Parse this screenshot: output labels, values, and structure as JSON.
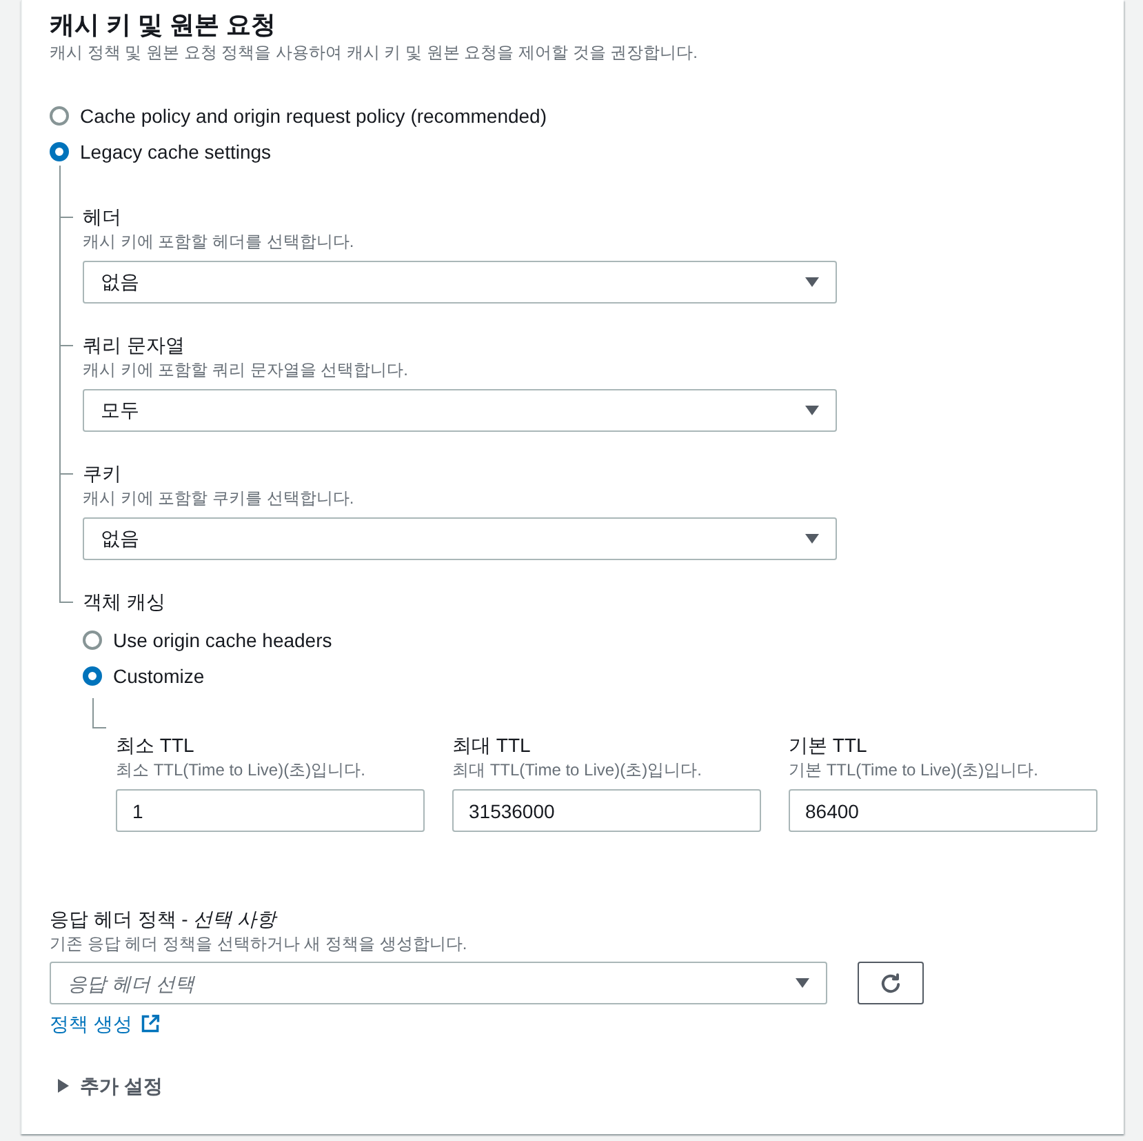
{
  "section": {
    "title": "캐시 키 및 원본 요청",
    "description": "캐시 정책 및 원본 요청 정책을 사용하여 캐시 키 및 원본 요청을 제어할 것을 권장합니다."
  },
  "cache_options": [
    {
      "label": "Cache policy and origin request policy (recommended)",
      "selected": false
    },
    {
      "label": "Legacy cache settings",
      "selected": true
    }
  ],
  "legacy_settings": {
    "fields": [
      {
        "label": "헤더",
        "description": "캐시 키에 포함할 헤더를 선택합니다.",
        "value": "없음"
      },
      {
        "label": "쿼리 문자열",
        "description": "캐시 키에 포함할 쿼리 문자열을 선택합니다.",
        "value": "모두"
      },
      {
        "label": "쿠키",
        "description": "캐시 키에 포함할 쿠키를 선택합니다.",
        "value": "없음"
      }
    ],
    "object_caching": {
      "label": "객체 캐싱",
      "options": [
        {
          "label": "Use origin cache headers",
          "selected": false
        },
        {
          "label": "Customize",
          "selected": true
        }
      ],
      "ttl_fields": [
        {
          "label": "최소 TTL",
          "description": "최소 TTL(Time to Live)(초)입니다.",
          "value": "1"
        },
        {
          "label": "최대 TTL",
          "description": "최대 TTL(Time to Live)(초)입니다.",
          "value": "31536000"
        },
        {
          "label": "기본 TTL",
          "description": "기본 TTL(Time to Live)(초)입니다.",
          "value": "86400"
        }
      ]
    }
  },
  "response_headers_policy": {
    "label": "응답 헤더 정책 - *선택 사항*",
    "description": "기존 응답 헤더 정책을 선택하거나 새 정책을 생성합니다.",
    "placeholder": "응답 헤더 선택",
    "link": "정책 생성"
  },
  "additional_settings": {
    "label": "추가 설정",
    "expanded": false
  }
}
